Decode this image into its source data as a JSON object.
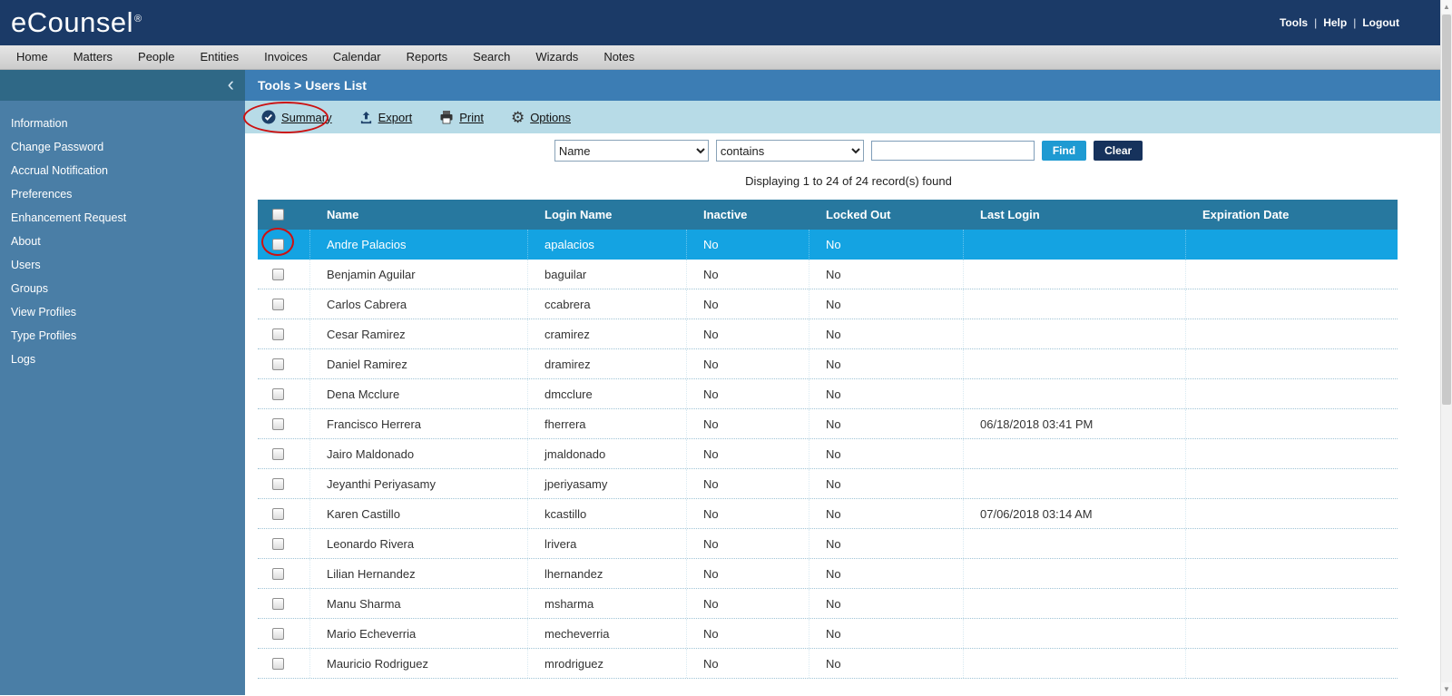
{
  "header": {
    "logo": "eCounsel",
    "logo_mark": "®",
    "links": [
      "Tools",
      "Help",
      "Logout"
    ]
  },
  "nav": {
    "tabs": [
      "Home",
      "Matters",
      "People",
      "Entities",
      "Invoices",
      "Calendar",
      "Reports",
      "Search",
      "Wizards",
      "Notes"
    ]
  },
  "sidebar": {
    "collapse_icon": "‹",
    "items": [
      "Information",
      "Change Password",
      "Accrual Notification",
      "Preferences",
      "Enhancement Request",
      "About",
      "Users",
      "Groups",
      "View Profiles",
      "Type Profiles",
      "Logs"
    ]
  },
  "breadcrumb": "Tools > Users List",
  "toolbar": {
    "summary_label": "Summary",
    "export_label": "Export",
    "print_label": "Print",
    "options_label": "Options"
  },
  "search": {
    "field_selected": "Name",
    "operator_selected": "contains",
    "input_value": "",
    "find_label": "Find",
    "clear_label": "Clear"
  },
  "status_text": "Displaying 1 to 24 of 24 record(s) found",
  "table": {
    "columns": [
      "Name",
      "Login Name",
      "Inactive",
      "Locked Out",
      "Last Login",
      "Expiration Date"
    ],
    "selected_row_index": 0,
    "rows": [
      {
        "name": "Andre Palacios",
        "login": "apalacios",
        "inactive": "No",
        "locked": "No",
        "last_login": "",
        "expiration": ""
      },
      {
        "name": "Benjamin Aguilar",
        "login": "baguilar",
        "inactive": "No",
        "locked": "No",
        "last_login": "",
        "expiration": ""
      },
      {
        "name": "Carlos Cabrera",
        "login": "ccabrera",
        "inactive": "No",
        "locked": "No",
        "last_login": "",
        "expiration": ""
      },
      {
        "name": "Cesar Ramirez",
        "login": "cramirez",
        "inactive": "No",
        "locked": "No",
        "last_login": "",
        "expiration": ""
      },
      {
        "name": "Daniel Ramirez",
        "login": "dramirez",
        "inactive": "No",
        "locked": "No",
        "last_login": "",
        "expiration": ""
      },
      {
        "name": "Dena Mcclure",
        "login": "dmcclure",
        "inactive": "No",
        "locked": "No",
        "last_login": "",
        "expiration": ""
      },
      {
        "name": "Francisco Herrera",
        "login": "fherrera",
        "inactive": "No",
        "locked": "No",
        "last_login": "06/18/2018 03:41 PM",
        "expiration": ""
      },
      {
        "name": "Jairo Maldonado",
        "login": "jmaldonado",
        "inactive": "No",
        "locked": "No",
        "last_login": "",
        "expiration": ""
      },
      {
        "name": "Jeyanthi Periyasamy",
        "login": "jperiyasamy",
        "inactive": "No",
        "locked": "No",
        "last_login": "",
        "expiration": ""
      },
      {
        "name": "Karen Castillo",
        "login": "kcastillo",
        "inactive": "No",
        "locked": "No",
        "last_login": "07/06/2018 03:14 AM",
        "expiration": ""
      },
      {
        "name": "Leonardo Rivera",
        "login": "lrivera",
        "inactive": "No",
        "locked": "No",
        "last_login": "",
        "expiration": ""
      },
      {
        "name": "Lilian Hernandez",
        "login": "lhernandez",
        "inactive": "No",
        "locked": "No",
        "last_login": "",
        "expiration": ""
      },
      {
        "name": "Manu Sharma",
        "login": "msharma",
        "inactive": "No",
        "locked": "No",
        "last_login": "",
        "expiration": ""
      },
      {
        "name": "Mario Echeverria",
        "login": "mecheverria",
        "inactive": "No",
        "locked": "No",
        "last_login": "",
        "expiration": ""
      },
      {
        "name": "Mauricio Rodriguez",
        "login": "mrodriguez",
        "inactive": "No",
        "locked": "No",
        "last_login": "",
        "expiration": ""
      }
    ]
  },
  "colors": {
    "header_bg": "#1b3a67",
    "nav_bg": "#d8d8d8",
    "sidebar_bg": "#4a7ea6",
    "sidebar_top_bg": "#2f6886",
    "breadcrumb_bg": "#3c7db4",
    "toolbar_bg": "#b7dbe7",
    "table_header_bg": "#27789f",
    "selected_row_bg": "#14a3e2",
    "find_button_bg": "#1e9ad2",
    "clear_button_bg": "#16325c",
    "annotation_red": "#cc1111"
  }
}
